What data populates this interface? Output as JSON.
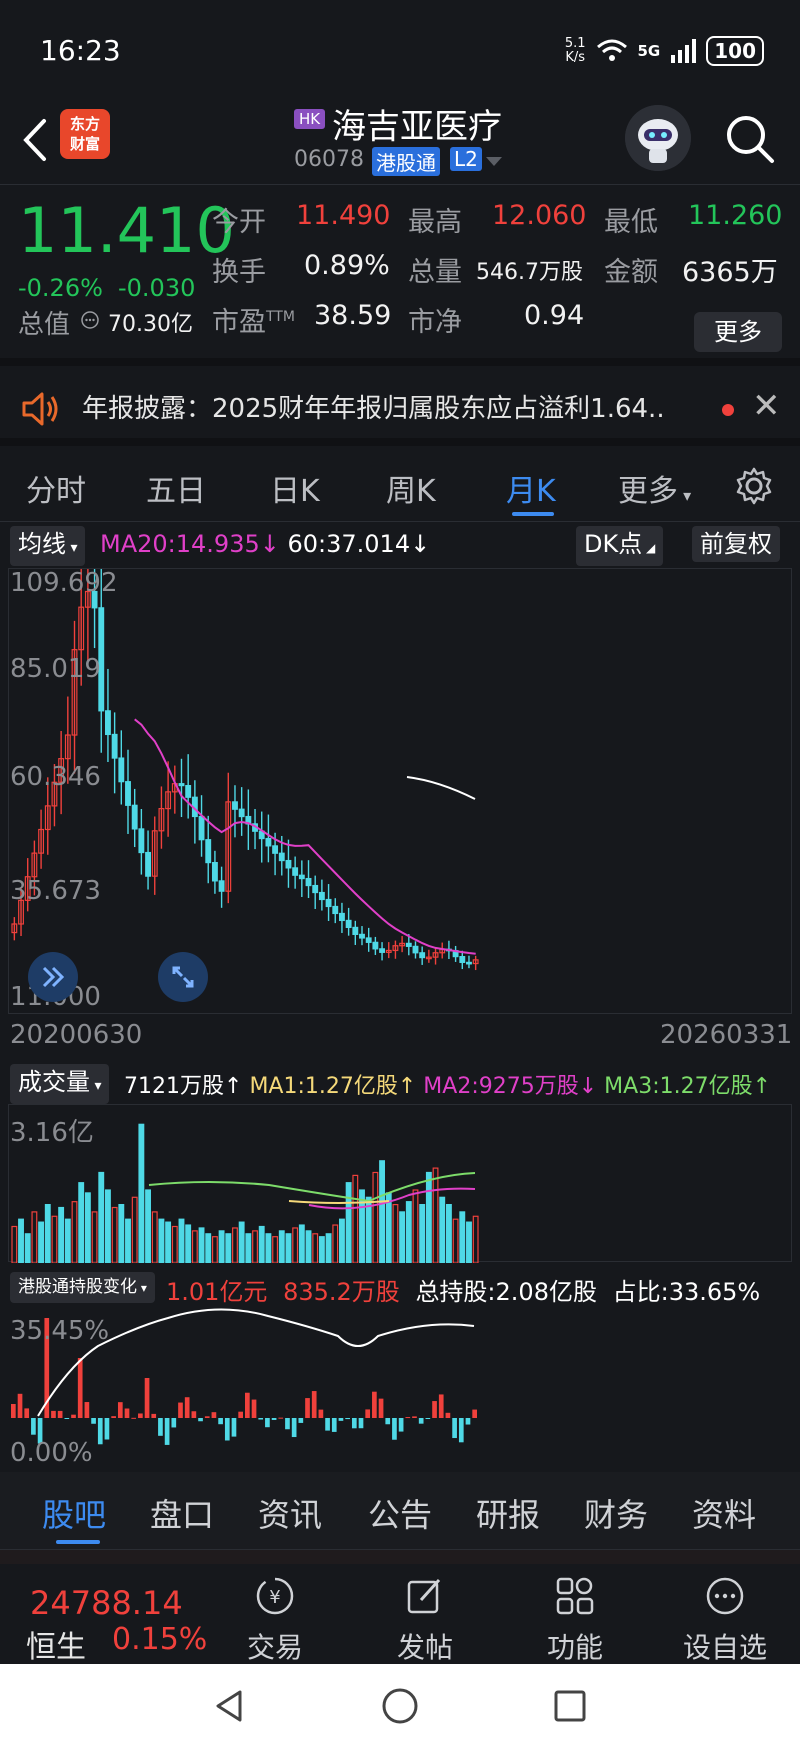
{
  "status": {
    "time": "16:23",
    "speed_top": "5.1",
    "speed_unit": "K/s",
    "network": "5G",
    "battery": "100"
  },
  "header": {
    "logo_line1": "东方",
    "logo_line2": "财富",
    "market_badge": "HK",
    "name": "海吉亚医疗",
    "code": "06078",
    "tag_connect": "港股通",
    "tag_level": "L2"
  },
  "quote": {
    "price": "11.410",
    "change_pct": "-0.26%",
    "change_abs": "-0.030",
    "open_label": "今开",
    "open": "11.490",
    "high_label": "最高",
    "high": "12.060",
    "low_label": "最低",
    "low": "11.260",
    "turnover_label": "换手",
    "turnover": "0.89%",
    "volume_label": "总量",
    "volume": "546.7万股",
    "amount_label": "金额",
    "amount": "6365万",
    "mktcap_label": "总值",
    "mktcap": "70.30亿",
    "pe_label": "市盈",
    "pe_sup": "TTM",
    "pe": "38.59",
    "pb_label": "市净",
    "pb": "0.94",
    "more": "更多"
  },
  "notice": {
    "text": "年报披露：2025财年年报归属股东应占溢利1.64.."
  },
  "tabs": [
    "分时",
    "五日",
    "日K",
    "周K",
    "月K",
    "更多"
  ],
  "kline": {
    "ma_selector": "均线",
    "ma20": "MA20:14.935↓",
    "ma60": "60:37.014↓",
    "dk_button": "DK点",
    "adjust_button": "前复权",
    "y_labels": [
      "109.692",
      "85.019",
      "60.346",
      "35.673",
      "11.000"
    ],
    "date_start": "20200630",
    "date_end": "20260331"
  },
  "volume": {
    "selector": "成交量",
    "value": "7121万股↑",
    "ma1": "MA1:1.27亿股↑",
    "ma2": "MA2:9275万股↓",
    "ma3": "MA3:1.27亿股↑",
    "y_max": "3.16亿"
  },
  "holding": {
    "selector": "港股通持股变化",
    "amount": "1.01亿元",
    "shares": "835.2万股",
    "total": "总持股:2.08亿股",
    "ratio": "占比:33.65%",
    "y_max": "35.45%",
    "y_min": "0.00%"
  },
  "subnav": [
    "股吧",
    "盘口",
    "资讯",
    "公告",
    "研报",
    "财务",
    "资料"
  ],
  "bottom": {
    "index_value": "24788.14",
    "index_name": "恒生",
    "index_pct": "0.15%",
    "items": [
      "交易",
      "发帖",
      "功能",
      "设自选"
    ]
  },
  "colors": {
    "up": "#f0413c",
    "down": "#4fd9e6",
    "accent": "#3d8bf0",
    "ma20": "#e040c8",
    "ma60": "#ffffff"
  }
}
